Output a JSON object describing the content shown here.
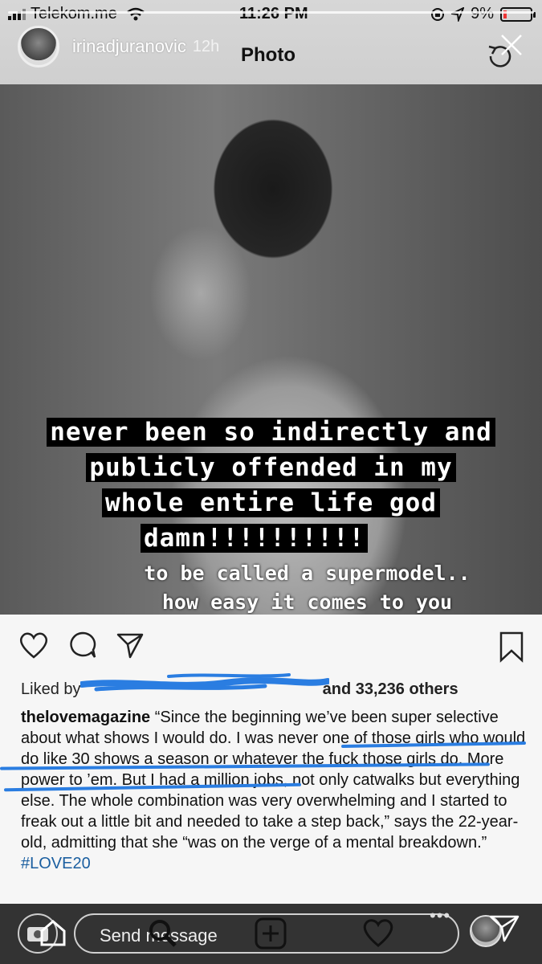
{
  "status": {
    "carrier": "Telekom.me",
    "time": "11:26 PM",
    "battery": "9%"
  },
  "story": {
    "username": "irinadjuranovic",
    "age": "12h",
    "title": "Photo"
  },
  "overlay": {
    "lines": [
      "never been so indirectly and",
      "publicly offended in my",
      "whole entire life god",
      "damn!!!!!!!!!!"
    ],
    "sub_lines": [
      "to be called a supermodel..",
      "how easy it comes to you"
    ]
  },
  "post": {
    "liked_by_prefix": "Liked by",
    "liked_by_suffix": "and 33,236 others",
    "caption_user": "thelovemagazine",
    "caption_text": "“Since the beginning we’ve been super selective about what shows I would do. I was never one of those girls who would do like 30 shows a season or whatever the fuck those girls do. More power to ’em. But I had a million jobs, not only catwalks but everything else. The whole combination was very overwhelming and I started to freak out a little bit and needed to take a step back,” says the 22-year-old, admitting that she “was on the verge of a mental breakdown.”",
    "caption_tag": "#LOVE20"
  },
  "reply": {
    "placeholder": "Send message",
    "more": "•••"
  },
  "colors": {
    "underline": "#2a7de1",
    "hashtag": "#1b5fa0",
    "battery_low": "#e33"
  }
}
